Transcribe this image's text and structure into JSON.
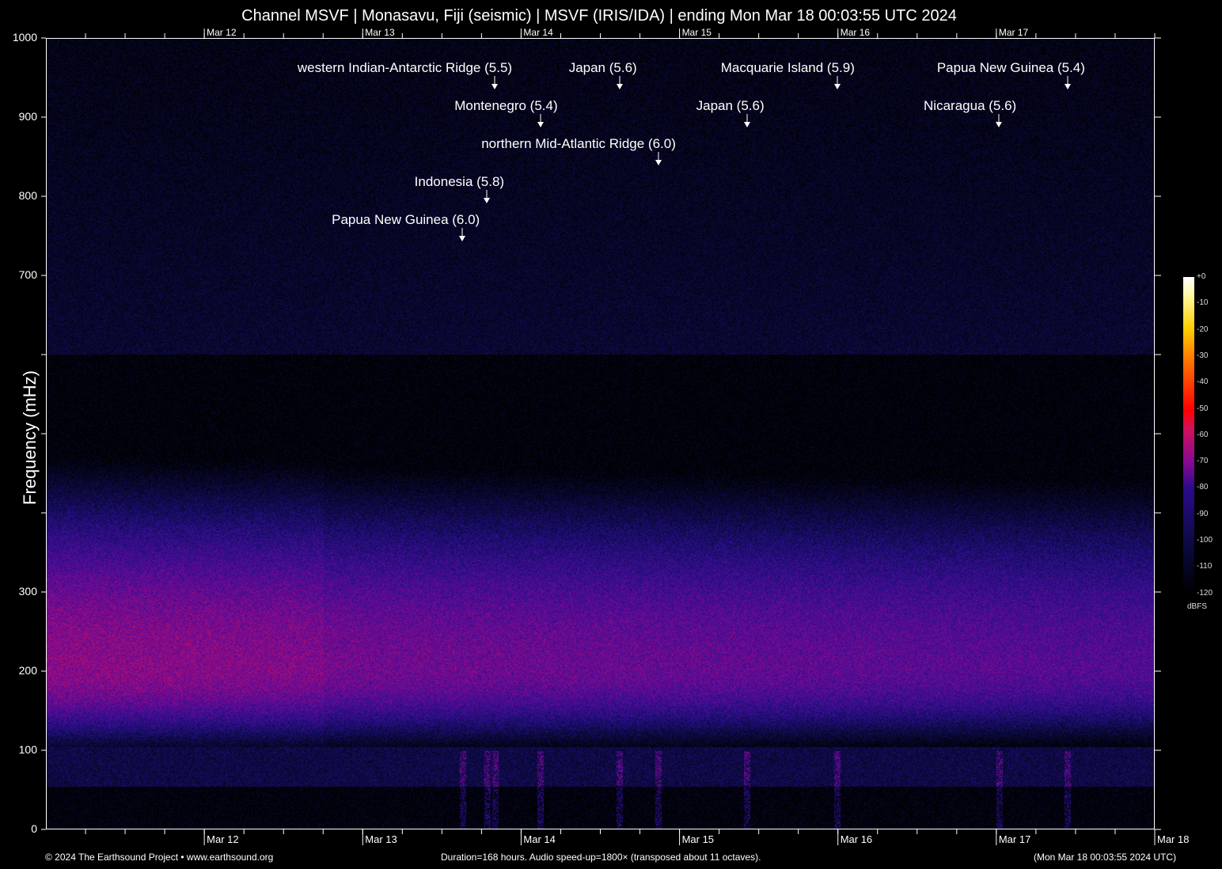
{
  "chart_data": {
    "type": "heatmap",
    "title": "Channel MSVF | Monasavu, Fiji (seismic) | MSVF (IRIS/IDA) | ending Mon Mar 18 00:03:55 UTC 2024",
    "ylabel": "Frequency (mHz)",
    "ylim": [
      0,
      1000
    ],
    "y_ticks": [
      0,
      100,
      200,
      300,
      400,
      500,
      600,
      700,
      800,
      900,
      1000
    ],
    "y_tick_labels": [
      "0",
      "100",
      "200",
      "300",
      "",
      "",
      "",
      "700",
      "800",
      "900",
      "1000"
    ],
    "duration_hours": 168,
    "x_tick_labels": [
      "Mar 12",
      "Mar 13",
      "Mar 14",
      "Mar 15",
      "Mar 16",
      "Mar 17",
      "Mar 18"
    ],
    "x_tick_hours": [
      24,
      48,
      72,
      96,
      120,
      144,
      168
    ],
    "colorbar": {
      "label": "dBFS",
      "range": [
        -120,
        0
      ],
      "ticks": [
        "+0",
        "-10",
        "-20",
        "-30",
        "-40",
        "-50",
        "-60",
        "-70",
        "-80",
        "-90",
        "-100",
        "-110",
        "-120"
      ]
    },
    "events": [
      {
        "label": "western Indian-Antarctic Ridge (5.5)",
        "hour": 68.0
      },
      {
        "label": "Japan (5.6)",
        "hour": 86.9
      },
      {
        "label": "Macquarie Island (5.9)",
        "hour": 119.9
      },
      {
        "label": "Papua New Guinea (5.4)",
        "hour": 154.8
      },
      {
        "label": "Montenegro (5.4)",
        "hour": 74.9
      },
      {
        "label": "Japan (5.6)",
        "hour": 106.2
      },
      {
        "label": "Nicaragua (5.6)",
        "hour": 144.4
      },
      {
        "label": "northern Mid-Atlantic Ridge (6.0)",
        "hour": 92.8
      },
      {
        "label": "Indonesia (5.8)",
        "hour": 66.8
      },
      {
        "label": "Papua New Guinea (6.0)",
        "hour": 63.1
      }
    ]
  },
  "footer": {
    "copyright": "© 2024 The Earthsound Project • www.earthsound.org",
    "info": "Duration=168 hours. Audio speed-up=1800× (transposed about 11 octaves).",
    "end_time": "(Mon Mar 18 00:03:55 2024 UTC)"
  }
}
